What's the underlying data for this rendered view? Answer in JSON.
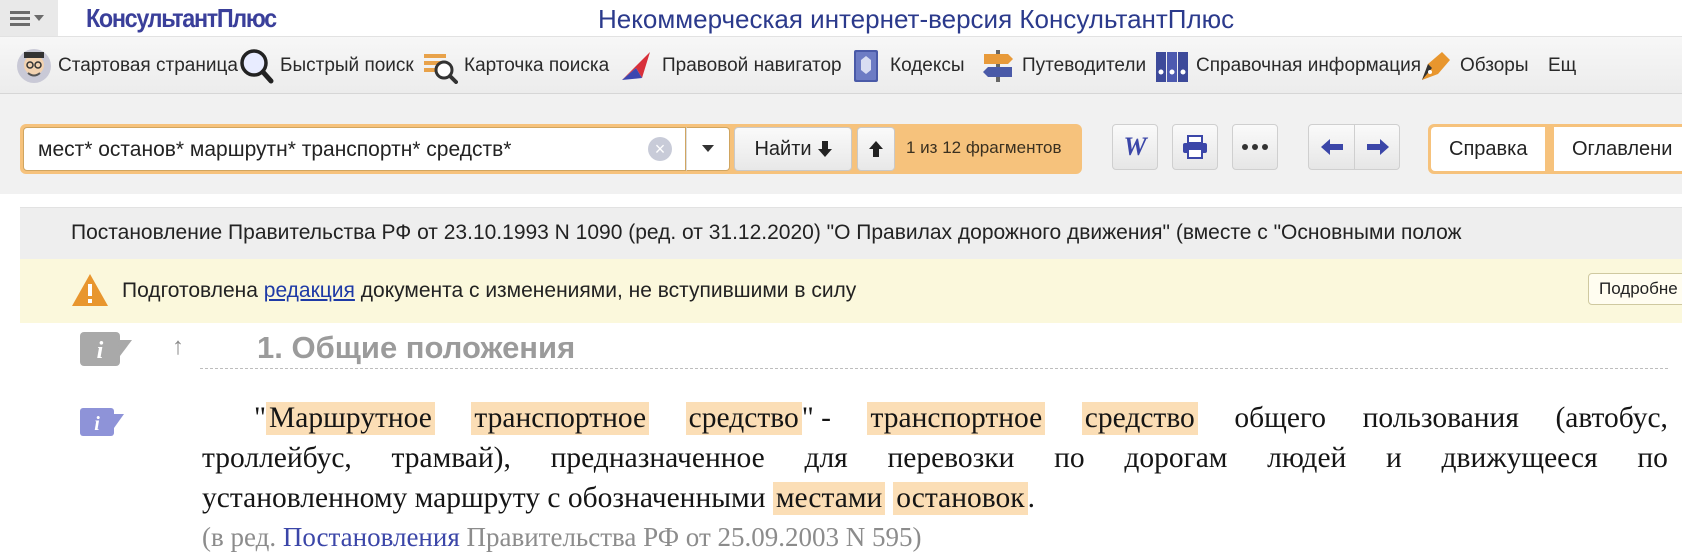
{
  "titlebar": {
    "logo": "КонсультантПлюс",
    "title": "Некоммерческая интернет-версия КонсультантПлюс"
  },
  "nav": {
    "items": [
      {
        "label": "Стартовая страница",
        "icon": "professor-icon"
      },
      {
        "label": "Быстрый поиск",
        "icon": "magnifier-icon"
      },
      {
        "label": "Карточка поиска",
        "icon": "search-card-icon"
      },
      {
        "label": "Правовой навигатор",
        "icon": "navigator-icon"
      },
      {
        "label": "Кодексы",
        "icon": "codex-book-icon"
      },
      {
        "label": "Путеводители",
        "icon": "signpost-icon"
      },
      {
        "label": "Справочная информация",
        "icon": "binders-icon"
      },
      {
        "label": "Обзоры",
        "icon": "pen-icon"
      },
      {
        "label": "Ещ",
        "icon": ""
      }
    ]
  },
  "search": {
    "query": "мест* останов* маршрутн* транспортн* средств*",
    "find_label": "Найти",
    "fragments": "1 из 12 фрагментов"
  },
  "tabs": [
    "Справка",
    "Оглавлени"
  ],
  "document": {
    "title": "Постановление Правительства РФ от 23.10.1993 N 1090 (ред. от 31.12.2020) \"О Правилах дорожного движения\" (вместе с \"Основными полож",
    "notice_before": "Подготовлена ",
    "notice_link": "редакция",
    "notice_after": " документа с изменениями, не вступившими в силу",
    "more_button": "Подробне",
    "section_heading": "1. Общие положения",
    "line1": [
      "\"",
      "Маршрутное",
      "транспортное",
      "средство",
      "\" -",
      "транспортное",
      "средство",
      "общего",
      "пользования",
      "(автобус,"
    ],
    "line2": [
      "троллейбус,",
      "трамвай),",
      "предназначенное",
      "для",
      "перевозки",
      "по",
      "дорогам",
      "людей",
      "и",
      "движущееся",
      "по"
    ],
    "line3_before": "установленному маршруту с обозначенными ",
    "line3_hl1": "местами",
    "line3_hl2": "остановок",
    "line3_after": ".",
    "redline_before": "(в ред. ",
    "redline_link": "Постановления",
    "redline_after": " Правительства РФ от 25.09.2003 N 595)"
  },
  "colors": {
    "brand": "#2b3a8c",
    "search_accent": "#f6c27c",
    "highlight": "#fbdeb6",
    "notice_bg": "#fbf8dc",
    "info_icon": "#8e93d8"
  }
}
